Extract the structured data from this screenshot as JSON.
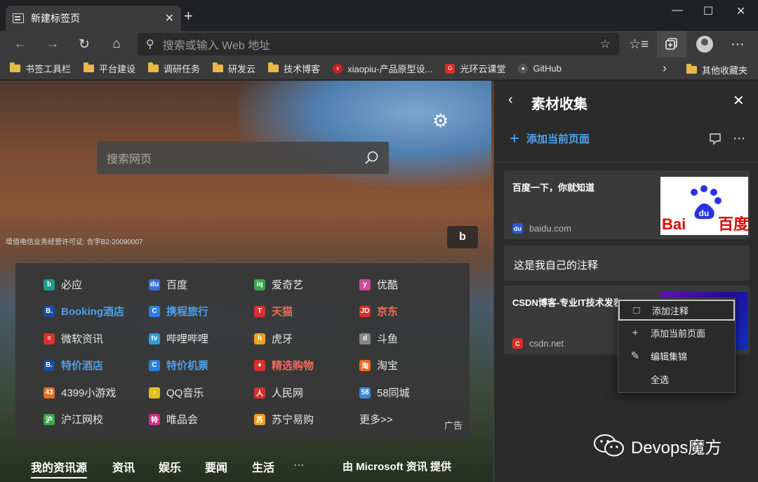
{
  "window": {
    "tab_title": "新建标签页",
    "tab_close": "✕",
    "new_tab": "+",
    "minimize": "—",
    "maximize": "☐",
    "close": "✕"
  },
  "navbar": {
    "back": "←",
    "forward": "→",
    "refresh": "↻",
    "home": "⌂",
    "address_placeholder": "搜索或输入 Web 地址",
    "favorite_star": "☆",
    "favorites_list": "☆≡",
    "more": "⋯"
  },
  "bookmarks": [
    {
      "label": "书签工具栏",
      "icon": "folder-icon"
    },
    {
      "label": "平台建设",
      "icon": "folder-icon"
    },
    {
      "label": "调研任务",
      "icon": "folder-icon"
    },
    {
      "label": "研发云",
      "icon": "folder-icon"
    },
    {
      "label": "技术博客",
      "icon": "folder-icon"
    },
    {
      "label": "xiaopiu-产品原型设...",
      "icon": "xiaopiu-icon"
    },
    {
      "label": "光环云课堂",
      "icon": "guanghuan-icon"
    },
    {
      "label": "GitHub",
      "icon": "github-icon"
    }
  ],
  "bookmarks_overflow": "›",
  "bookmarks_other": "其他收藏夹",
  "ntp": {
    "search_placeholder": "搜索网页",
    "license": "增值电信业务经营许可证: 合字B2-20090007",
    "bing_label": "b",
    "ad_label": "广告",
    "quicklinks": [
      {
        "label": "必应",
        "style": "normal",
        "icon_color": "#1a9c8a",
        "glyph": "b"
      },
      {
        "label": "百度",
        "style": "normal",
        "icon_color": "#3a6fd8",
        "glyph": "du"
      },
      {
        "label": "爱奇艺",
        "style": "normal",
        "icon_color": "#3aa84a",
        "glyph": "iq"
      },
      {
        "label": "优酷",
        "style": "normal",
        "icon_color": "#d04a9a",
        "glyph": "y"
      },
      {
        "label": "Booking酒店",
        "style": "blue",
        "icon_color": "#1b4ca0",
        "glyph": "B."
      },
      {
        "label": "携程旅行",
        "style": "blue",
        "icon_color": "#2a7fe0",
        "glyph": "C"
      },
      {
        "label": "天猫",
        "style": "red",
        "icon_color": "#d8302a",
        "glyph": "T"
      },
      {
        "label": "京东",
        "style": "red",
        "icon_color": "#d8302a",
        "glyph": "JD"
      },
      {
        "label": "微软资讯",
        "style": "normal",
        "icon_color": "#d8302a",
        "glyph": "≡"
      },
      {
        "label": "哔哩哔哩",
        "style": "normal",
        "icon_color": "#2aa0d8",
        "glyph": "tv"
      },
      {
        "label": "虎牙",
        "style": "normal",
        "icon_color": "#f0a020",
        "glyph": "h"
      },
      {
        "label": "斗鱼",
        "style": "normal",
        "icon_color": "#888888",
        "glyph": "d"
      },
      {
        "label": "特价酒店",
        "style": "blue",
        "icon_color": "#1b4ca0",
        "glyph": "B."
      },
      {
        "label": "特价机票",
        "style": "blue",
        "icon_color": "#2a7fe0",
        "glyph": "C"
      },
      {
        "label": "精选购物",
        "style": "red",
        "icon_color": "#d8302a",
        "glyph": "♦"
      },
      {
        "label": "淘宝",
        "style": "normal",
        "icon_color": "#f06a20",
        "glyph": "淘"
      },
      {
        "label": "4399小游戏",
        "style": "normal",
        "icon_color": "#e07020",
        "glyph": "43"
      },
      {
        "label": "QQ音乐",
        "style": "normal",
        "icon_color": "#e0c020",
        "glyph": "♪"
      },
      {
        "label": "人民网",
        "style": "normal",
        "icon_color": "#d8302a",
        "glyph": "人"
      },
      {
        "label": "58同城",
        "style": "normal",
        "icon_color": "#3a8ad8",
        "glyph": "58"
      },
      {
        "label": "沪江网校",
        "style": "normal",
        "icon_color": "#3aa84a",
        "glyph": "沪"
      },
      {
        "label": "唯品会",
        "style": "normal",
        "icon_color": "#d0308a",
        "glyph": "特"
      },
      {
        "label": "苏宁易购",
        "style": "normal",
        "icon_color": "#f0a020",
        "glyph": "苏"
      },
      {
        "label": "更多>>",
        "style": "normal",
        "icon_color": "",
        "glyph": ""
      }
    ],
    "feed_tabs": [
      "我的资讯源",
      "资讯",
      "娱乐",
      "要闻",
      "生活",
      "⋯"
    ],
    "provider": "由 Microsoft 资讯 提供"
  },
  "panel": {
    "back": "‹",
    "title": "素材收集",
    "close": "✕",
    "add_current": "添加当前页面",
    "cards": [
      {
        "title": "百度一下，你就知道",
        "site": "baidu.com"
      },
      {
        "note": "这是我自己的注释"
      },
      {
        "title": "CSDN博客-专业IT技术发表平台",
        "site": "csdn.net"
      }
    ],
    "baidu_logo_text": "Bai百度",
    "context_menu": [
      {
        "label": "添加注释",
        "icon": "note-icon"
      },
      {
        "label": "添加当前页面",
        "icon": "plus-icon"
      },
      {
        "label": "编辑集锦",
        "icon": "pencil-icon"
      },
      {
        "label": "全选",
        "icon": ""
      }
    ]
  },
  "watermark": "Devops魔方"
}
